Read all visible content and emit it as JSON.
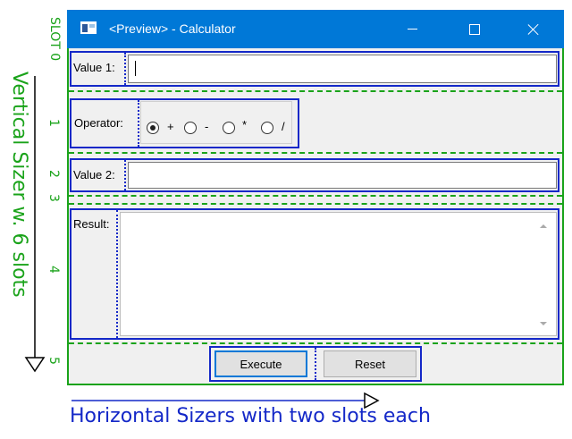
{
  "window": {
    "title": "<Preview> - Calculator",
    "controls": [
      "minimize",
      "maximize",
      "close"
    ]
  },
  "form": {
    "value1_label": "Value 1:",
    "value1_value": "",
    "operator_label": "Operator:",
    "operators": [
      {
        "label": "+",
        "checked": true
      },
      {
        "label": "-",
        "checked": false
      },
      {
        "label": "*",
        "checked": false
      },
      {
        "label": "/",
        "checked": false
      }
    ],
    "value2_label": "Value 2:",
    "value2_value": "",
    "result_label": "Result:",
    "result_value": "",
    "execute_label": "Execute",
    "reset_label": "Reset"
  },
  "annotations": {
    "slot_labels": [
      "SLOT 0",
      "1",
      "2",
      "3",
      "4",
      "5"
    ],
    "vertical_caption": "Vertical Sizer w. 6 slots",
    "horizontal_caption": "Horizontal Sizers with two slots each"
  },
  "colors": {
    "titlebar": "#0078d7",
    "vertical_sizer": "#1aa31a",
    "horizontal_sizer": "#1428c8",
    "client_bg": "#f0f0f0"
  }
}
